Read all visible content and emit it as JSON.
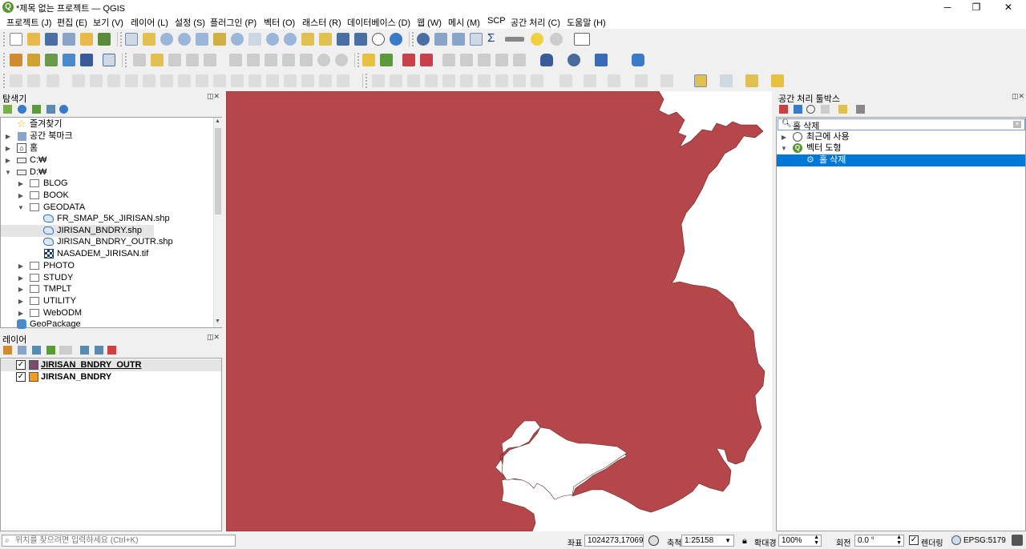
{
  "window": {
    "title": "*제목 없는 프로젝트 — QGIS",
    "minimize": "─",
    "maximize": "❐",
    "close": "✕"
  },
  "menu": [
    "프로젝트 (J)",
    "편집 (E)",
    "보기 (V)",
    "레이어 (L)",
    "설정 (S)",
    "플러그인 (P)",
    "벡터 (O)",
    "래스터 (R)",
    "데이터베이스 (D)",
    "웹 (W)",
    "메시 (M)",
    "SCP",
    "공간 처리 (C)",
    "도움말 (H)"
  ],
  "browser": {
    "title": "탐색기",
    "items": [
      {
        "label": "즐겨찾기",
        "icon": "star-icon"
      },
      {
        "label": "공간 북마크",
        "icon": "bookmark-icon"
      },
      {
        "label": "홈",
        "icon": "home-icon"
      },
      {
        "label": "C:₩",
        "icon": "drive-icon"
      },
      {
        "label": "D:₩",
        "icon": "drive-icon"
      },
      {
        "label": "BLOG",
        "icon": "folder-icon"
      },
      {
        "label": "BOOK",
        "icon": "folder-icon"
      },
      {
        "label": "GEODATA",
        "icon": "folder-icon"
      },
      {
        "label": "FR_SMAP_5K_JIRISAN.shp",
        "icon": "vector-layer-icon"
      },
      {
        "label": "JIRISAN_BNDRY.shp",
        "icon": "vector-layer-icon"
      },
      {
        "label": "JIRISAN_BNDRY_OUTR.shp",
        "icon": "vector-layer-icon"
      },
      {
        "label": "NASADEM_JIRISAN.tif",
        "icon": "raster-layer-icon"
      },
      {
        "label": "PHOTO",
        "icon": "folder-icon"
      },
      {
        "label": "STUDY",
        "icon": "folder-icon"
      },
      {
        "label": "TMPLT",
        "icon": "folder-icon"
      },
      {
        "label": "UTILITY",
        "icon": "folder-icon"
      },
      {
        "label": "WebODM",
        "icon": "folder-icon"
      },
      {
        "label": "GeoPackage",
        "icon": "geopackage-icon"
      }
    ]
  },
  "layers": {
    "title": "레이어",
    "items": [
      {
        "label": "JIRISAN_BNDRY_OUTR",
        "color": "#7b4a6e",
        "checked": true,
        "selected": true
      },
      {
        "label": "JIRISAN_BNDRY",
        "color": "#f39c1e",
        "checked": true,
        "selected": false
      }
    ]
  },
  "toolbox": {
    "title": "공간 처리 툴박스",
    "search_value": "홀 삭제",
    "items": [
      {
        "label": "최근에 사용"
      },
      {
        "label": "벡터 도형"
      },
      {
        "label": "홀 삭제"
      }
    ]
  },
  "map": {
    "fill_color": "#b5474b",
    "background": "#ffffff"
  },
  "status": {
    "locator_placeholder": "위치를 찾으려면 입력하세요 (Ctrl+K)",
    "coord_label": "좌표",
    "coord_value": "1024273,1706962",
    "scale_label": "축척",
    "scale_value": "1:25158",
    "magnifier_label": "확대경",
    "magnifier_value": "100%",
    "rotation_label": "회전",
    "rotation_value": "0.0 °",
    "render_label": "렌더링",
    "crs": "EPSG:5179"
  }
}
